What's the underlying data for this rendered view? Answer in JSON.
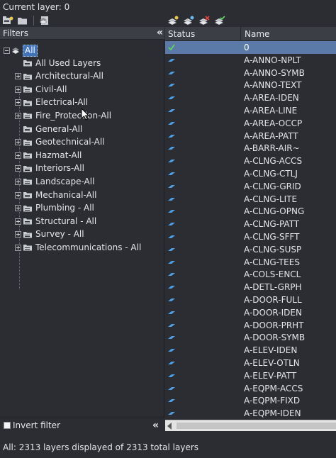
{
  "header": {
    "current_layer_text": "Current layer: 0"
  },
  "left_toolbar": {
    "icons": [
      "new-property-filter-icon",
      "new-group-filter-icon",
      "layer-states-manager-icon"
    ]
  },
  "right_toolbar": {
    "icons": [
      "new-layer-icon",
      "new-layer-vp-frozen-icon",
      "delete-layer-icon",
      "set-current-icon"
    ]
  },
  "filters": {
    "title": "Filters",
    "collapse_glyph": "«",
    "root": {
      "label": "All",
      "selected": true
    },
    "items": [
      {
        "label": "All Used Layers",
        "expandable": false
      },
      {
        "label": "Architectural-All",
        "expandable": true
      },
      {
        "label": "Civil-All",
        "expandable": true
      },
      {
        "label": "Electrical-All",
        "expandable": true
      },
      {
        "label": "Fire_Protection-All",
        "expandable": true
      },
      {
        "label": "General-All",
        "expandable": false
      },
      {
        "label": "Geotechnical-All",
        "expandable": true
      },
      {
        "label": "Hazmat-All",
        "expandable": true
      },
      {
        "label": "Interiors-All",
        "expandable": true
      },
      {
        "label": "Landscape-All",
        "expandable": true
      },
      {
        "label": "Mechanical-All",
        "expandable": true
      },
      {
        "label": "Plumbing - All",
        "expandable": true
      },
      {
        "label": "Structural - All",
        "expandable": true
      },
      {
        "label": "Survey - All",
        "expandable": true
      },
      {
        "label": "Telecommunications - All",
        "expandable": true
      }
    ],
    "invert_filter_label": "Invert filter",
    "invert_filter_checked": false
  },
  "layer_list": {
    "columns": {
      "status": "Status",
      "name": "Name"
    },
    "layers": [
      {
        "status": "current",
        "name": "0"
      },
      {
        "status": "in-use",
        "name": "A-ANNO-NPLT"
      },
      {
        "status": "in-use",
        "name": "A-ANNO-SYMB"
      },
      {
        "status": "in-use",
        "name": "A-ANNO-TEXT"
      },
      {
        "status": "in-use",
        "name": "A-AREA-IDEN"
      },
      {
        "status": "in-use",
        "name": "A-AREA-LINE"
      },
      {
        "status": "in-use",
        "name": "A-AREA-OCCP"
      },
      {
        "status": "in-use",
        "name": "A-AREA-PATT"
      },
      {
        "status": "in-use",
        "name": "A-BARR-AIR~"
      },
      {
        "status": "in-use",
        "name": "A-CLNG-ACCS"
      },
      {
        "status": "in-use",
        "name": "A-CLNG-CTLJ"
      },
      {
        "status": "in-use",
        "name": "A-CLNG-GRID"
      },
      {
        "status": "in-use",
        "name": "A-CLNG-LITE"
      },
      {
        "status": "in-use",
        "name": "A-CLNG-OPNG"
      },
      {
        "status": "in-use",
        "name": "A-CLNG-PATT"
      },
      {
        "status": "in-use",
        "name": "A-CLNG-SFFT"
      },
      {
        "status": "in-use",
        "name": "A-CLNG-SUSP"
      },
      {
        "status": "in-use",
        "name": "A-CLNG-TEES"
      },
      {
        "status": "in-use",
        "name": "A-COLS-ENCL"
      },
      {
        "status": "in-use",
        "name": "A-DETL-GRPH"
      },
      {
        "status": "in-use",
        "name": "A-DOOR-FULL"
      },
      {
        "status": "in-use",
        "name": "A-DOOR-IDEN"
      },
      {
        "status": "in-use",
        "name": "A-DOOR-PRHT"
      },
      {
        "status": "in-use",
        "name": "A-DOOR-SYMB"
      },
      {
        "status": "in-use",
        "name": "A-ELEV-IDEN"
      },
      {
        "status": "in-use",
        "name": "A-ELEV-OTLN"
      },
      {
        "status": "in-use",
        "name": "A-ELEV-PATT"
      },
      {
        "status": "in-use",
        "name": "A-EQPM-ACCS"
      },
      {
        "status": "in-use",
        "name": "A-EQPM-FIXD"
      },
      {
        "status": "in-use",
        "name": "A-EQPM-IDEN"
      }
    ]
  },
  "status_bar": {
    "text": "All: 2313 layers displayed of 2313 total layers"
  },
  "colors": {
    "background": "#2b2d33",
    "header": "#3b3e45",
    "selection": "#3f72bb",
    "current_row": "#5c7aa8",
    "status_check": "#5fd35f",
    "status_in_use": "#4f9fe6"
  }
}
